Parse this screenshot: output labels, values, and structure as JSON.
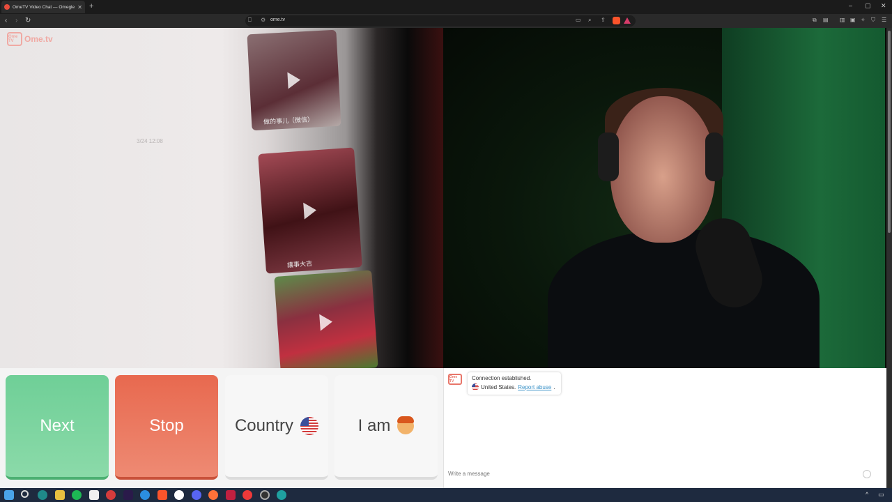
{
  "browser": {
    "tab_title": "OmeTV Video Chat — Omegle",
    "new_tab": "+",
    "url": "ome.tv",
    "window_controls": [
      "–",
      "▢",
      "✕"
    ]
  },
  "brand": {
    "logo_box": "Ome TV",
    "logo_text": "Ome.tv"
  },
  "remote_video": {
    "date_overlay": "3/24 12:08",
    "captions": [
      "做的事儿（微信）",
      "議事大吉"
    ]
  },
  "buttons": {
    "next": "Next",
    "stop": "Stop",
    "country": "Country",
    "iam": "I am"
  },
  "chat": {
    "avatar": "Ome TV",
    "status": "Connection established.",
    "country": "United States.",
    "report": "Report abuse",
    "report_suffix": ".",
    "input_placeholder": "Write a message"
  },
  "colors": {
    "next": "#6fcf97",
    "stop": "#e8694f",
    "link": "#3d93c8",
    "brand": "#f0a9a3"
  },
  "taskbar": {
    "icons": [
      "windows-icon",
      "search-icon",
      "edge-copilot-icon",
      "file-explorer-icon",
      "spotify-icon",
      "notes-icon",
      "chrome-icon",
      "after-effects-icon",
      "edge-icon",
      "brave-icon",
      "google-icon",
      "discord-icon",
      "firefox-icon",
      "app-icon",
      "vivaldi-icon",
      "obs-icon",
      "edge-dev-icon"
    ]
  }
}
